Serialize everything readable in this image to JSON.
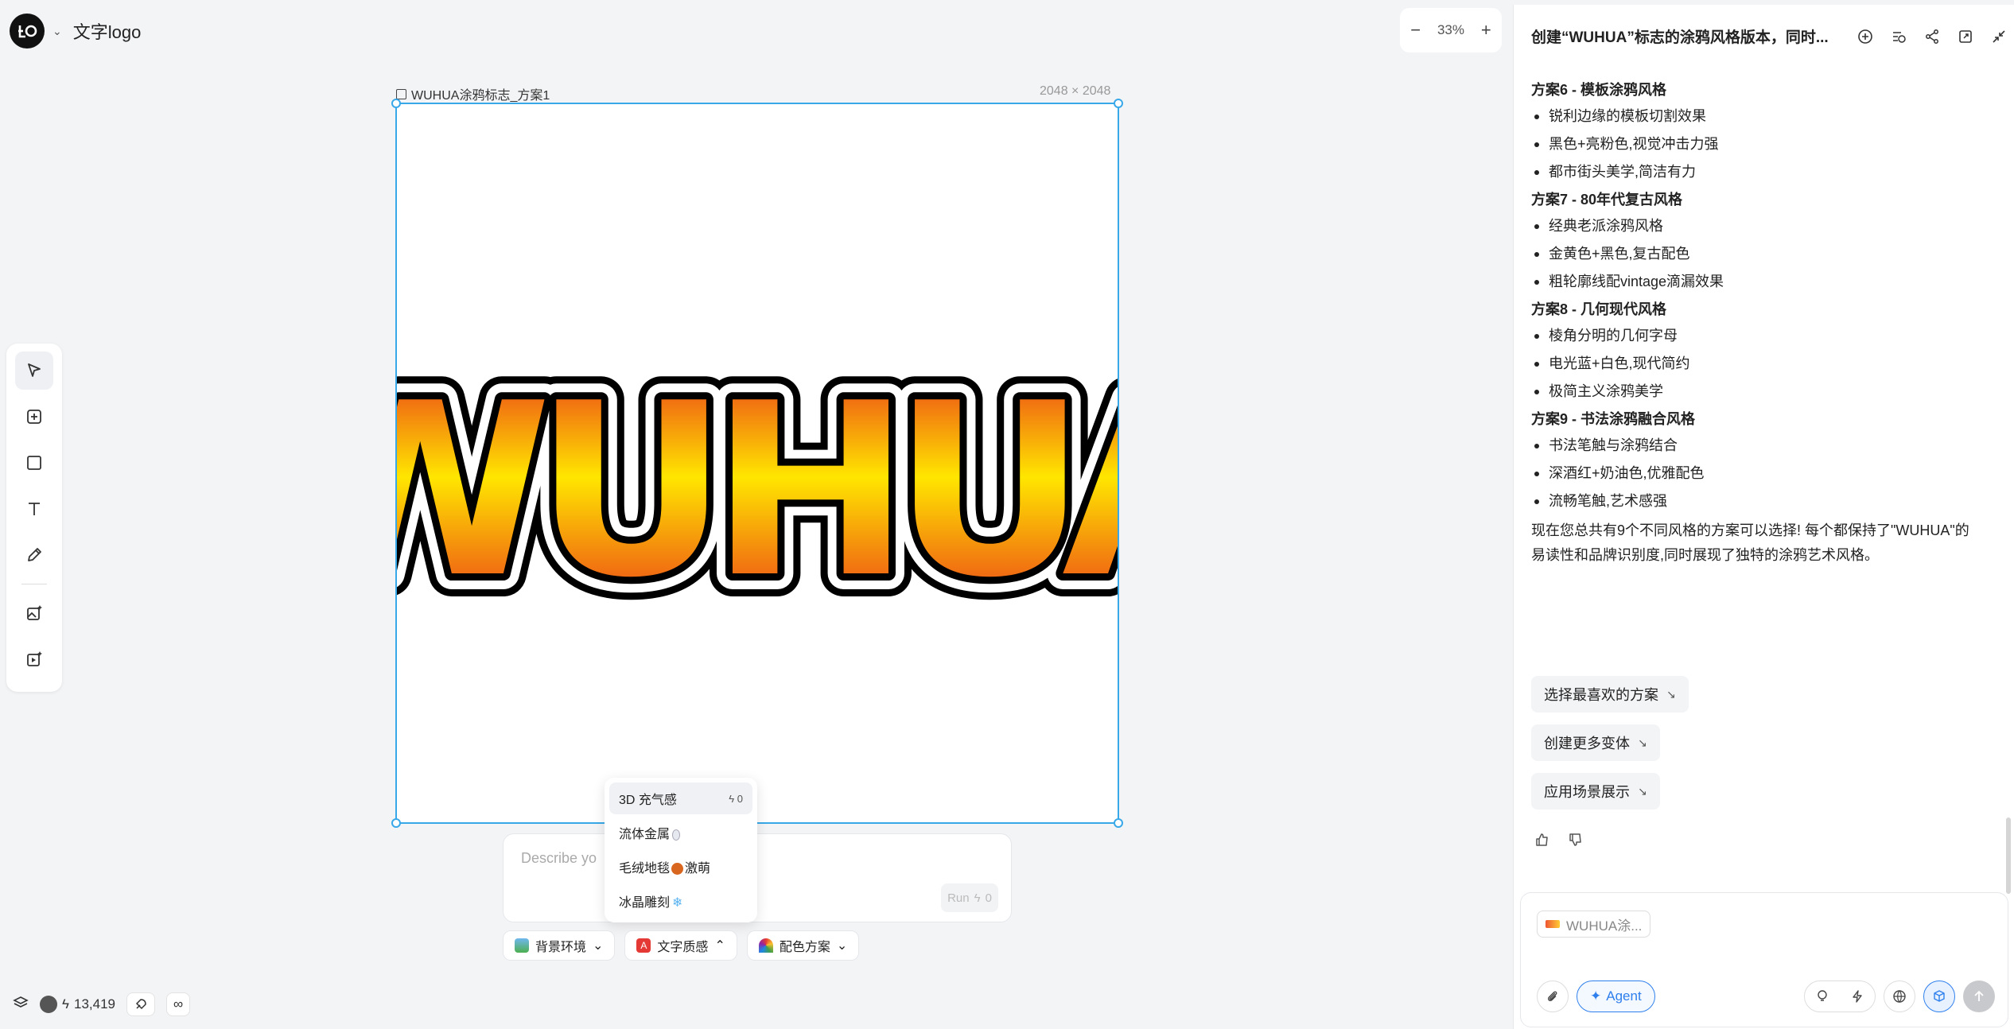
{
  "project": {
    "title": "文字logo"
  },
  "zoom": {
    "minus": "−",
    "value": "33%",
    "plus": "+"
  },
  "artboard": {
    "name": "WUHUA涂鸦标志_方案1",
    "size": "2048 × 2048",
    "graffiti_text": "WUHUA"
  },
  "composer": {
    "placeholder": "Describe yo",
    "run_label": "Run",
    "run_cost": "0"
  },
  "dropdown": {
    "items": [
      {
        "label": "3D 充气感",
        "badge": "0"
      },
      {
        "label": "流体金属"
      },
      {
        "label": "毛绒地毯",
        "suffix": "激萌"
      },
      {
        "label": "冰晶雕刻"
      }
    ]
  },
  "chips": [
    {
      "label": "背景环境",
      "caret": "⌄"
    },
    {
      "label": "文字质感",
      "caret": "⌃"
    },
    {
      "label": "配色方案",
      "caret": "⌄"
    }
  ],
  "status": {
    "credits": "13,419",
    "infinity": "∞"
  },
  "chat": {
    "title": "创建“WUHUA”标志的涂鸦风格版本，同时...",
    "sections": [
      {
        "heading": "方案6 - 模板涂鸦风格",
        "items": [
          "锐利边缘的模板切割效果",
          "黑色+亮粉色,视觉冲击力强",
          "都市街头美学,简洁有力"
        ]
      },
      {
        "heading": "方案7 - 80年代复古风格",
        "items": [
          "经典老派涂鸦风格",
          "金黄色+黑色,复古配色",
          "粗轮廓线配vintage滴漏效果"
        ]
      },
      {
        "heading": "方案8 - 几何现代风格",
        "items": [
          "棱角分明的几何字母",
          "电光蓝+白色,现代简约",
          "极简主义涂鸦美学"
        ]
      },
      {
        "heading": "方案9 - 书法涂鸦融合风格",
        "items": [
          "书法笔触与涂鸦结合",
          "深酒红+奶油色,优雅配色",
          "流畅笔触,艺术感强"
        ]
      }
    ],
    "summary": "现在您总共有9个不同风格的方案可以选择! 每个都保持了\"WUHUA\"的易读性和品牌识别度,同时展现了独特的涂鸦艺术风格。",
    "suggestions": [
      "选择最喜欢的方案",
      "创建更多变体",
      "应用场景展示"
    ],
    "suggestion_arrow": "↘",
    "input": {
      "ref_label": "WUHUA涂...",
      "agent_label": "Agent"
    }
  },
  "colors": {
    "accent": "#38a8e8",
    "agent": "#2f80ed",
    "graffiti_red": "#e8281c",
    "graffiti_yellow": "#ffe600"
  }
}
